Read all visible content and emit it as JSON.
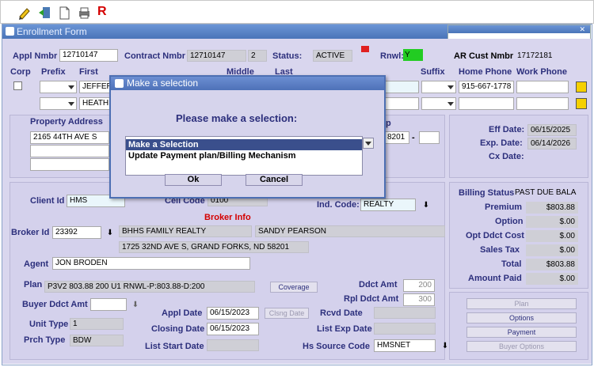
{
  "toolbar": {
    "r_label": "R"
  },
  "window": {
    "title": "Enrollment Form"
  },
  "header": {
    "appl_nmbr_label": "Appl Nmbr",
    "appl_nmbr": "12710147",
    "contract_nmbr_label": "Contract Nmbr",
    "contract_nmbr": "12710147",
    "contract_seq": "2",
    "status_label": "Status:",
    "status": "ACTIVE",
    "rnwl_label": "Rnwl:",
    "rnwl": "Y",
    "ar_cust_label": "AR Cust Nmbr",
    "ar_cust": "17172181"
  },
  "names": {
    "corp_label": "Corp",
    "prefix_label": "Prefix",
    "first_label": "First",
    "middle_label": "Middle",
    "last_label": "Last",
    "suffix_label": "Suffix",
    "home_phone_label": "Home Phone",
    "work_phone_label": "Work Phone",
    "row1_first": "JEFFERY",
    "row2_first": "HEATHE",
    "row1_home_phone": "915-667-1778"
  },
  "property": {
    "label": "Property Address",
    "line1": "2165 44TH AVE S",
    "zip_tail": "8201",
    "dash": "-",
    "hidden_label_tail": "p"
  },
  "dates": {
    "eff_label": "Eff Date:",
    "eff": "06/15/2025",
    "exp_label": "Exp. Date:",
    "exp": "06/14/2026",
    "cx_label": "Cx Date:"
  },
  "client": {
    "client_id_label": "Client Id",
    "client_id": "HMS",
    "cell_code_label": "Cell Code",
    "cell_code": "0100",
    "ind_code_label": "Ind. Code:",
    "ind_code": "REALTY"
  },
  "broker": {
    "section_title": "Broker Info",
    "broker_id_label": "Broker Id",
    "broker_id": "23392",
    "broker_name": "BHHS FAMILY REALTY",
    "contact": "SANDY PEARSON",
    "address": "1725 32ND AVE S, GRAND FORKS, ND 58201",
    "agent_label": "Agent",
    "agent": "JON BRODEN"
  },
  "billing": {
    "status_label": "Billing Status",
    "status": "PAST DUE BALA",
    "premium_label": "Premium",
    "premium": "$803.88",
    "option_label": "Option",
    "option": "$.00",
    "opt_ddct_label": "Opt Ddct Cost",
    "opt_ddct": "$.00",
    "sales_tax_label": "Sales Tax",
    "sales_tax": "$.00",
    "total_label": "Total",
    "total": "$803.88",
    "amount_paid_label": "Amount Paid",
    "amount_paid": "$.00"
  },
  "plan": {
    "plan_label": "Plan",
    "plan": "P3V2 803.88 200 U1 RNWL-P:803.88-D:200",
    "coverage_button": "Coverage",
    "ddct_amt_label": "Ddct Amt",
    "ddct_amt": "200",
    "rpl_ddct_label": "Rpl Ddct Amt",
    "rpl_ddct": "300",
    "buyer_ddct_label": "Buyer Ddct Amt",
    "appl_date_label": "Appl Date",
    "appl_date": "06/15/2023",
    "clsng_date_button": "Clsng Date",
    "rcvd_date_label": "Rcvd Date",
    "unit_type_label": "Unit Type",
    "unit_type": "1",
    "closing_date_label": "Closing Date",
    "closing_date": "06/15/2023",
    "list_exp_label": "List Exp Date",
    "prch_type_label": "Prch Type",
    "prch_type": "BDW",
    "list_start_label": "List Start Date",
    "hs_source_label": "Hs Source Code",
    "hs_source": "HMSNET"
  },
  "side_buttons": {
    "plan": "Plan",
    "options": "Options",
    "payment": "Payment",
    "buyer_options": "Buyer Options"
  },
  "modal": {
    "title": "Make a selection",
    "prompt": "Please make a selection:",
    "options": [
      "Make a Selection",
      "Update Payment plan/Billing Mechanism"
    ],
    "ok": "Ok",
    "cancel": "Cancel"
  },
  "colors": {
    "accent": "#4a74b8",
    "form_bg": "#d9d6ee",
    "label": "#2c2f7c",
    "rnwl_green": "#22cc22",
    "broker_red": "#d40000"
  }
}
